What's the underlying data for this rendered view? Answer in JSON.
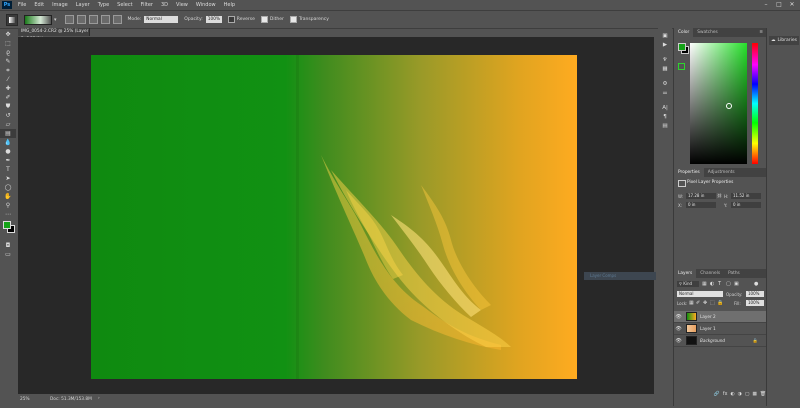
{
  "app": {
    "logo": "Ps",
    "menu": [
      "File",
      "Edit",
      "Image",
      "Layer",
      "Type",
      "Select",
      "Filter",
      "3D",
      "View",
      "Window",
      "Help"
    ],
    "window_controls": [
      "–",
      "□",
      "✕"
    ]
  },
  "options": {
    "mode_label": "Mode:",
    "mode_value": "Normal",
    "opacity_label": "Opacity:",
    "opacity_value": "100%",
    "reverse_label": "Reverse",
    "reverse_checked": false,
    "dither_label": "Dither",
    "dither_checked": true,
    "transparency_label": "Transparency",
    "transparency_checked": true
  },
  "document": {
    "tab_title": "IMG_0054-2.CR2 @ 25% (Layer 2, RGB/8*)",
    "tab_close": "×",
    "gradient_colors": [
      "#0f8a10",
      "#ffab20"
    ]
  },
  "status": {
    "zoom": "25%",
    "doc_info": "Doc: 51.3M/153.8M"
  },
  "colorpanel": {
    "tabs": [
      "Color",
      "Swatches"
    ],
    "fg_color": "#15a318",
    "bg_color": "#000000"
  },
  "libraries": {
    "label": "Libraries"
  },
  "properties": {
    "tabs": [
      "Properties",
      "Adjustments"
    ],
    "heading": "Pixel Layer Properties",
    "w_label": "W:",
    "w_value": "17.28 in",
    "h_label": "H:",
    "h_value": "11.52 in",
    "x_label": "X:",
    "x_value": "0 in",
    "y_label": "Y:",
    "y_value": "0 in",
    "link_icon": "⛓"
  },
  "layers": {
    "tabs": [
      "Layers",
      "Channels",
      "Paths"
    ],
    "filter_value": "Kind",
    "blend_mode": "Normal",
    "opacity_label": "Opacity:",
    "opacity_value": "100%",
    "lock_label": "Lock:",
    "fill_label": "Fill:",
    "fill_value": "100%",
    "items": [
      {
        "name": "Layer 2",
        "selected": true
      },
      {
        "name": "Layer 1",
        "selected": false
      },
      {
        "name": "Background",
        "selected": false
      }
    ],
    "footer_icons": [
      "🔗",
      "fx",
      "◐",
      "◑",
      "▢",
      "▦",
      "🗑"
    ]
  },
  "float_chip": {
    "label": "Layer Comps"
  }
}
